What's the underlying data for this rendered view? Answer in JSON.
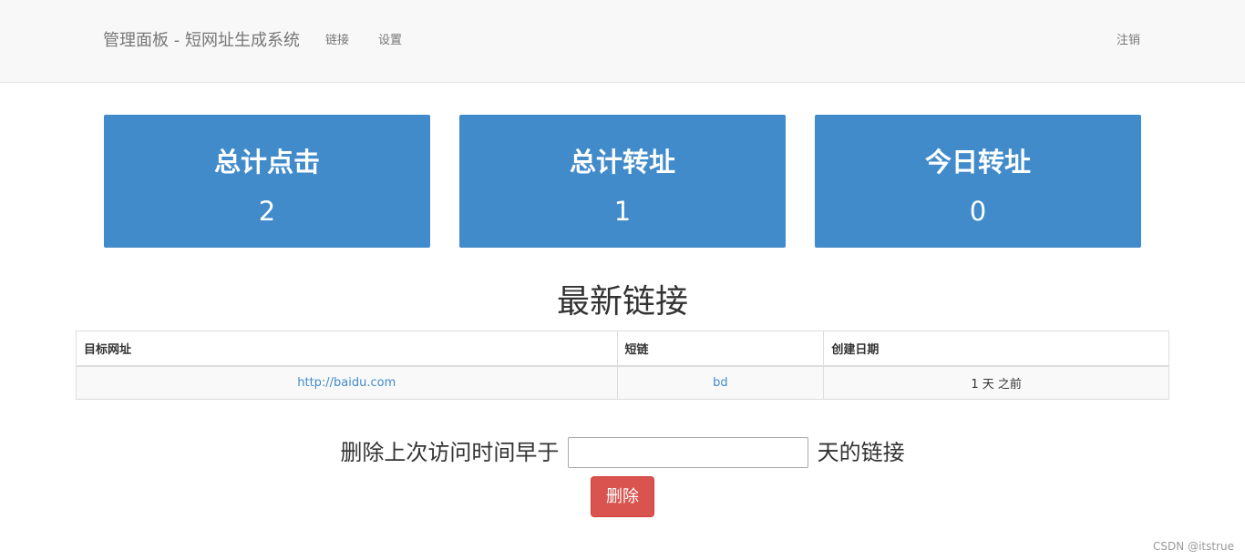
{
  "navbar": {
    "brand": "管理面板 - 短网址生成系统",
    "links_label": "链接",
    "settings_label": "设置",
    "logout_label": "注销"
  },
  "stats": [
    {
      "title": "总计点击",
      "value": "2"
    },
    {
      "title": "总计转址",
      "value": "1"
    },
    {
      "title": "今日转址",
      "value": "0"
    }
  ],
  "colors": {
    "card_bg": "#428bca",
    "danger": "#d9534f",
    "link": "#428bca",
    "navbar_bg": "#f8f8f8"
  },
  "recent": {
    "title": "最新链接",
    "columns": [
      "目标网址",
      "短链",
      "创建日期"
    ],
    "rows": [
      {
        "target": "http://baidu.com",
        "short": "bd",
        "created": "1 天 之前"
      }
    ]
  },
  "delete_form": {
    "prefix": "删除上次访问时间早于",
    "input_value": "",
    "suffix": "天的链接",
    "button_label": "删除"
  },
  "watermark": "CSDN @itstrue"
}
